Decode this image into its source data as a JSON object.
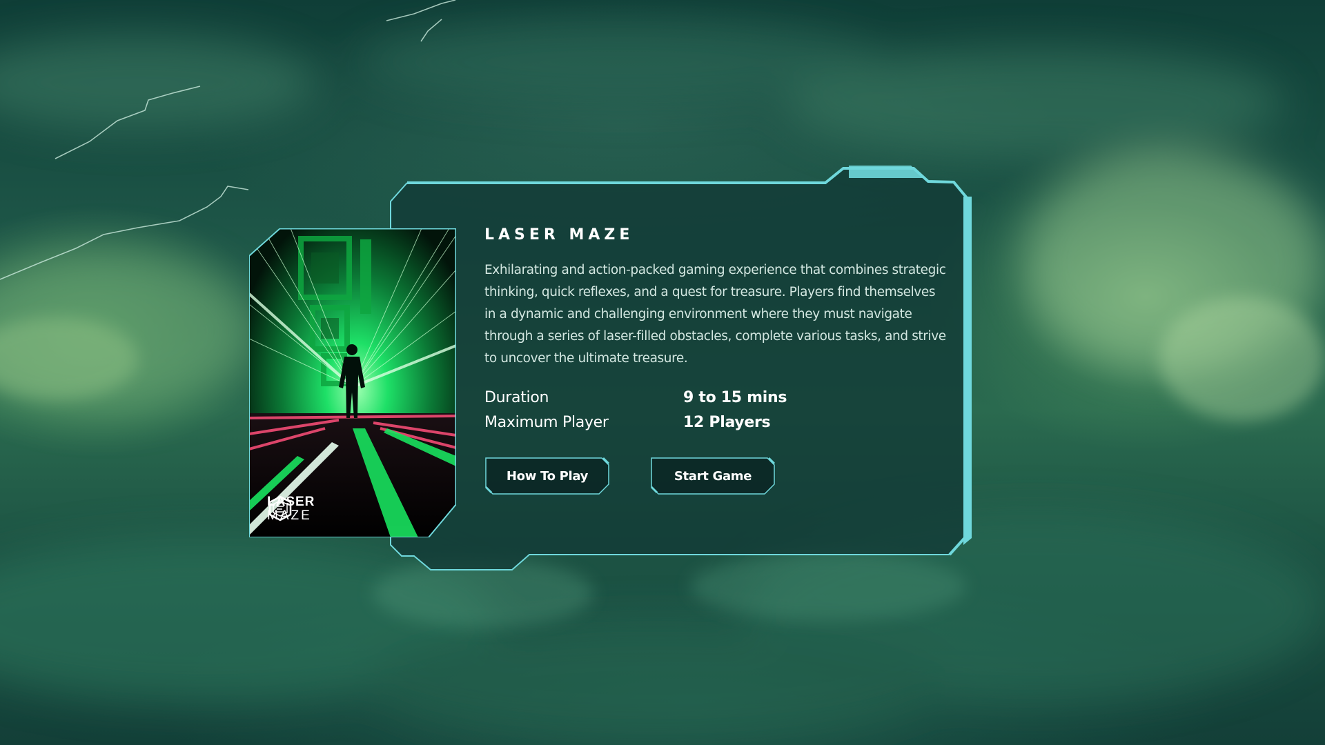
{
  "game": {
    "title": "LASER MAZE",
    "description": "Exhilarating and action-packed gaming experience that combines strategic thinking, quick reflexes, and a quest for treasure. Players find themselves in a dynamic and challenging environment where they must navigate through a series of laser-filled obstacles, complete various tasks, and strive to uncover the ultimate treasure.",
    "cover_logo_line1": "LASER",
    "cover_logo_line2": "MAZE",
    "cover_logo_icon": "hexagon-maze-logo-icon"
  },
  "stats": [
    {
      "label": "Duration",
      "value": "9 to 15 mins"
    },
    {
      "label": "Maximum Player",
      "value": "12 Players"
    }
  ],
  "buttons": {
    "how_to_play": "How To Play",
    "start_game": "Start Game"
  },
  "colors": {
    "frame_accent": "#6fd8dc",
    "laser_green": "#19e25f",
    "laser_pink": "#ff4f7a",
    "background_dark": "#123c36"
  }
}
